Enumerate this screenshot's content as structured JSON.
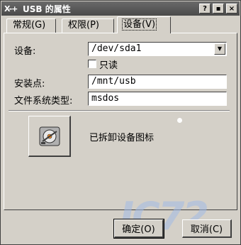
{
  "window": {
    "icon": "X-+",
    "title": "USB 的属性",
    "help_label": "?",
    "minimize_label": "▪",
    "close_label": "×"
  },
  "tabs": [
    {
      "label": "常规(G)",
      "active": false
    },
    {
      "label": "权限(P)",
      "active": false
    },
    {
      "label": "设备(V)",
      "active": true
    }
  ],
  "form": {
    "device_label": "设备:",
    "device_value": "/dev/sda1",
    "readonly_label": "只读",
    "readonly_checked": false,
    "mountpoint_label": "安装点:",
    "mountpoint_value": "/mnt/usb",
    "fstype_label": "文件系统类型:",
    "fstype_value": "msdos"
  },
  "icon_section": {
    "icon": "drive-icon",
    "text": "已拆卸设备图标"
  },
  "buttons": {
    "ok": "确定(O)",
    "cancel": "取消(C)"
  },
  "watermark": {
    "text": "IC72"
  }
}
